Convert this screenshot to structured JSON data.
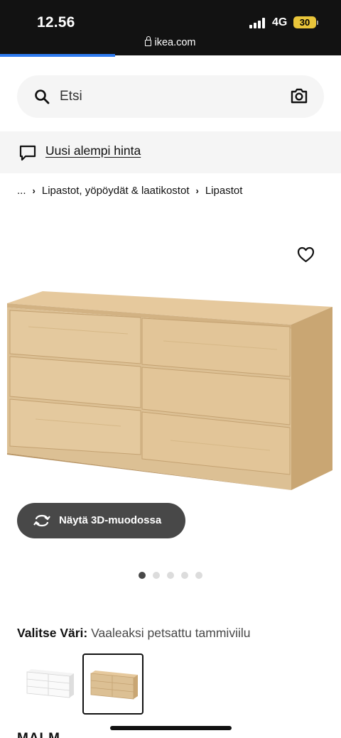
{
  "status_bar": {
    "time": "12.56",
    "network": "4G",
    "battery": "30",
    "url": "ikea.com"
  },
  "search": {
    "placeholder": "Etsi",
    "icon": "search-icon",
    "camera_icon": "camera-icon"
  },
  "banner": {
    "icon": "chat-bubble-icon",
    "link": "Uusi alempi hinta"
  },
  "breadcrumb": {
    "items": [
      "...",
      "Lipastot, yöpöydät & laatikostot",
      "Lipastot"
    ]
  },
  "product": {
    "image": "oak-veneer-chest-of-6-drawers",
    "favorite_icon": "heart-icon",
    "view_3d_label": "Näytä 3D-muodossa",
    "carousel": {
      "count": 5,
      "active": 1
    },
    "color_label": "Valitse Väri:",
    "color_value": "Vaaleaksi petsattu tammiviilu",
    "swatches": [
      {
        "name": "white",
        "selected": false
      },
      {
        "name": "oak",
        "selected": true
      }
    ],
    "name_peek": "MALM"
  },
  "colors": {
    "statusbar_bg": "#121212",
    "progress": "#2f7bf0",
    "battery": "#e9c53a",
    "light_bg": "#f5f5f5",
    "button_bg": "#484848"
  }
}
